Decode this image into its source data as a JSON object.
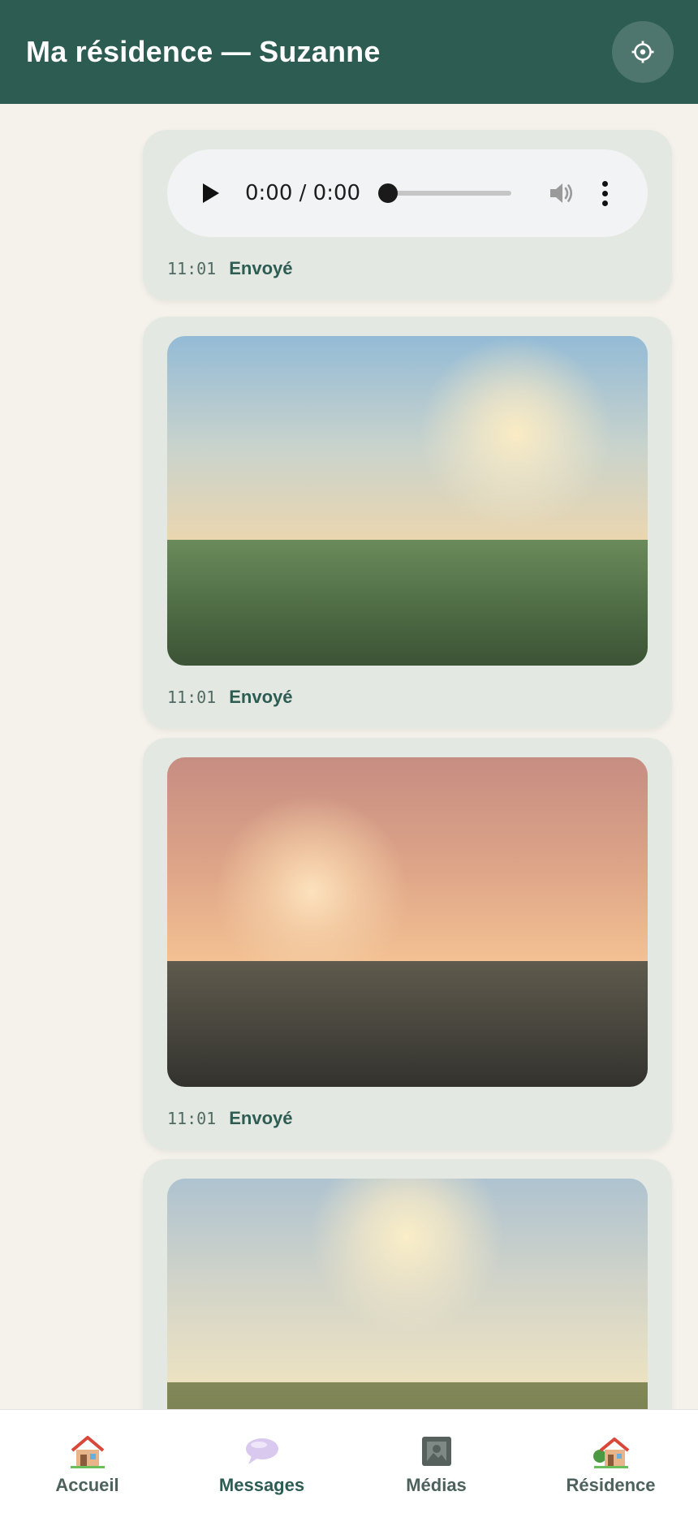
{
  "header": {
    "title": "Ma résidence — Suzanne",
    "settings_icon": "gear-icon"
  },
  "messages": [
    {
      "kind": "audio",
      "audio": {
        "time": "0:00 / 0:00",
        "progress": 0
      },
      "time": "11:01",
      "status": "Envoyé"
    },
    {
      "kind": "photo",
      "scene": "blue sky over green field",
      "time": "11:01",
      "status": "Envoyé"
    },
    {
      "kind": "photo",
      "scene": "pink sunset over dark land",
      "time": "11:01",
      "status": "Envoyé"
    },
    {
      "kind": "photo",
      "scene": "pale sky over olive field"
    }
  ],
  "nav": {
    "active": "messages",
    "items": [
      {
        "id": "accueil",
        "label": "Accueil",
        "icon": "house-icon"
      },
      {
        "id": "messages",
        "label": "Messages",
        "icon": "speech-bubble-icon"
      },
      {
        "id": "medias",
        "label": "Médias",
        "icon": "picture-frame-icon"
      },
      {
        "id": "residence",
        "label": "Résidence",
        "icon": "house-garden-icon"
      }
    ]
  },
  "colors": {
    "header": "#2d5c53",
    "background": "#f4f2ea",
    "bubble": "#e3e9e2",
    "accent_text": "#2d5c53"
  }
}
